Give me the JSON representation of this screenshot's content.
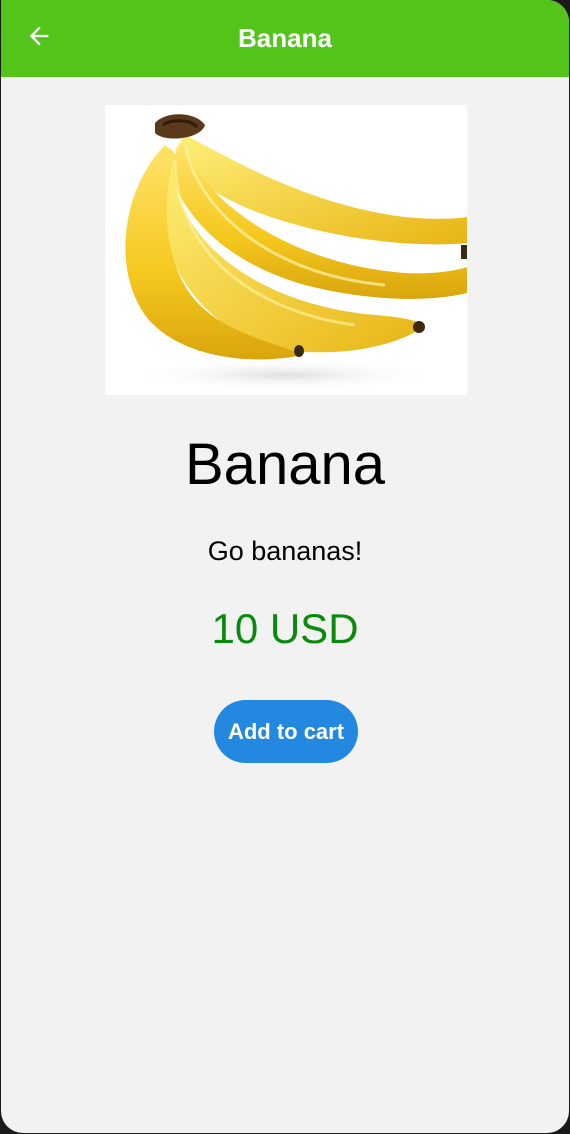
{
  "appbar": {
    "title": "Banana",
    "back_icon": "arrow-left-icon",
    "color": "#52c41a"
  },
  "product": {
    "image_subject": "bunch of bananas",
    "name": "Banana",
    "description": "Go bananas!",
    "price": "10 USD",
    "price_color": "#0a8a0a"
  },
  "actions": {
    "add_to_cart_label": "Add to cart",
    "button_color": "#2389e0"
  }
}
